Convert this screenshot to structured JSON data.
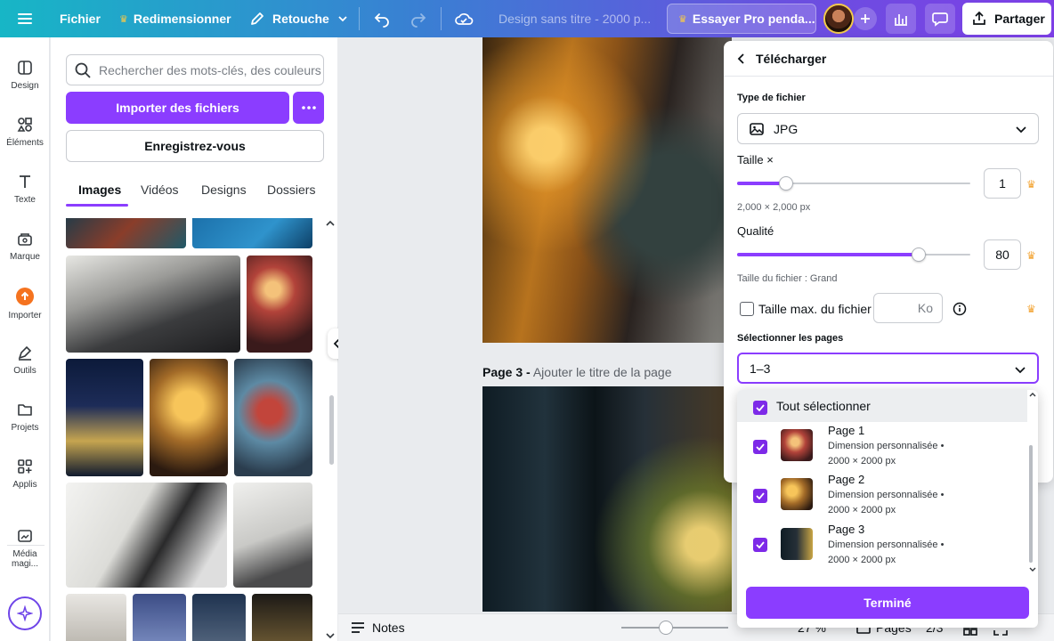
{
  "topbar": {
    "file": "Fichier",
    "resize": "Redimensionner",
    "retouch": "Retouche",
    "design_title": "Design sans titre - 2000 p...",
    "try_pro": "Essayer Pro penda...",
    "share": "Partager"
  },
  "rail": {
    "items": [
      "Design",
      "Éléments",
      "Texte",
      "Marque",
      "Importer",
      "Outils",
      "Projets",
      "Applis",
      "Média magi..."
    ]
  },
  "panel": {
    "search_placeholder": "Rechercher des mots-clés, des couleurs",
    "import_btn": "Importer des fichiers",
    "register_btn": "Enregistrez-vous",
    "tabs": [
      "Images",
      "Vidéos",
      "Designs",
      "Dossiers"
    ],
    "active_tab": "Images"
  },
  "canvas": {
    "page3_prefix": "Page 3 -",
    "page3_title_placeholder": "Ajouter le titre de la page"
  },
  "bottombar": {
    "notes": "Notes",
    "zoom": "27 %",
    "pages": "Pages",
    "page_counter": "2/3"
  },
  "dialog": {
    "title": "Télécharger",
    "file_type_label": "Type de fichier",
    "file_type_value": "JPG",
    "size_label": "Taille ×",
    "size_value": "1",
    "size_fraction": 0.21,
    "dimensions": "2,000 × 2,000 px",
    "quality_label": "Qualité",
    "quality_value": "80",
    "quality_fraction": 0.78,
    "file_size": "Taille du fichier : Grand",
    "max_size_label": "Taille max. du fichier",
    "max_size_unit": "Ko",
    "pages_label": "Sélectionner les pages",
    "pages_value": "1–3"
  },
  "dropdown": {
    "select_all": "Tout sélectionner",
    "pages": [
      {
        "name": "Page 1",
        "meta1": "Dimension personnalisée •",
        "meta2": "2000 × 2000 px"
      },
      {
        "name": "Page 2",
        "meta1": "Dimension personnalisée •",
        "meta2": "2000 × 2000 px"
      },
      {
        "name": "Page 3",
        "meta1": "Dimension personnalisée •",
        "meta2": "2000 × 2000 px"
      }
    ],
    "done": "Terminé"
  },
  "colors": {
    "accent": "#8b3dff",
    "check": "#7d2ae8",
    "crown": "#f3a536"
  }
}
